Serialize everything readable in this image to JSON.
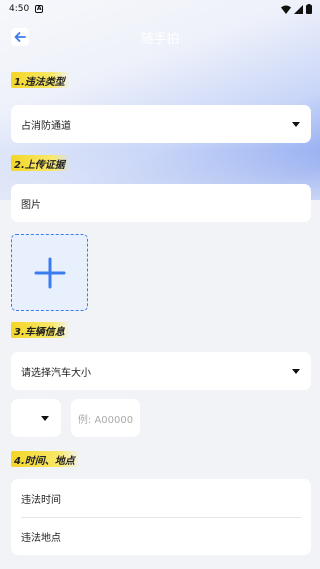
{
  "status_bar": {
    "time": "4:50",
    "notif_icon": "A"
  },
  "header": {
    "title": "随手拍"
  },
  "sections": {
    "violation": {
      "label": "1.违法类型",
      "selected": "占消防通道"
    },
    "evidence": {
      "label": "2.上传证据",
      "field": "图片"
    },
    "vehicle": {
      "label": "3.车辆信息",
      "select_placeholder": "请选择汽车大小",
      "plate_placeholder": "例: A00000"
    },
    "time_place": {
      "label": "4.时间、地点",
      "time_label": "违法时间",
      "place_label": "违法地点"
    }
  },
  "colors": {
    "accent": "#3a7cf0",
    "section_highlight": "#f4d628"
  }
}
